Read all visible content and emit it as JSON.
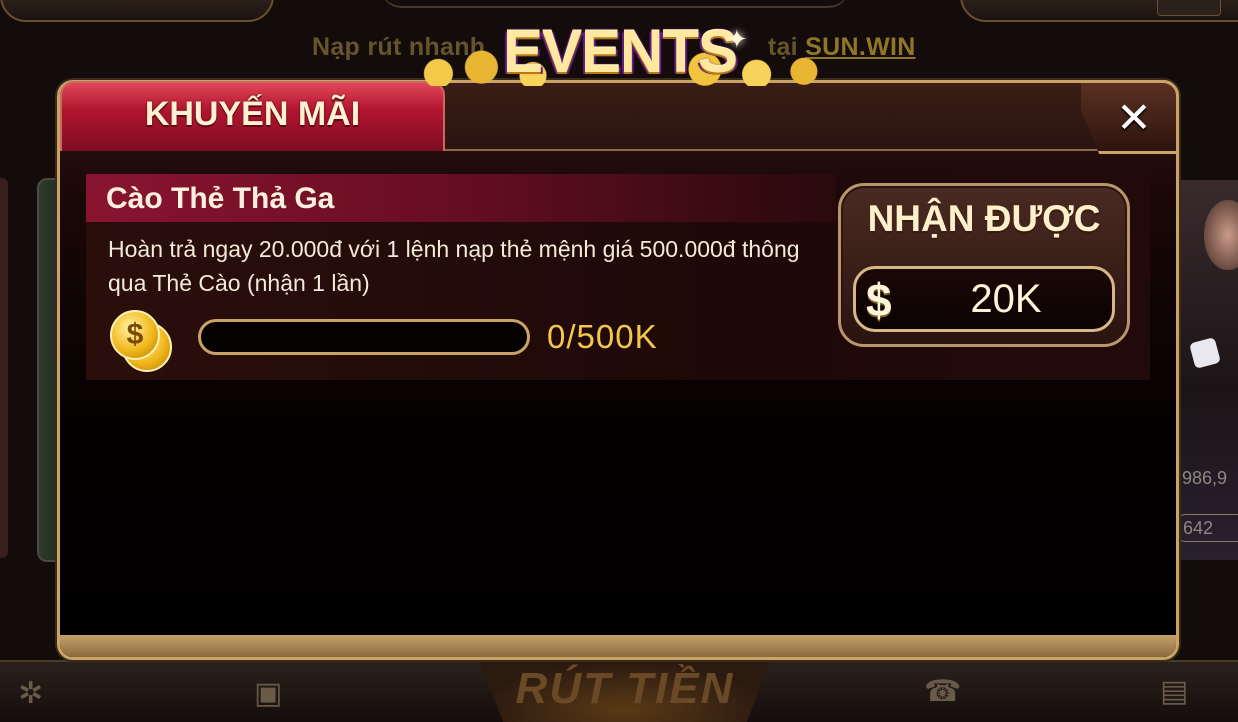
{
  "background": {
    "marquee": "Nạp rút nhanh",
    "marquee_tail": "tại",
    "marquee_domain": "SUN.WIN",
    "bottom_center": "RÚT TIỀN",
    "right_number_1": "986,9",
    "right_number_2": "642"
  },
  "events_badge": {
    "title": "EVENTS"
  },
  "popup": {
    "tab_label": "KHUYẾN MÃI",
    "close_symbol": "✕",
    "events": [
      {
        "title": "Cào Thẻ Thả Ga",
        "description": "Hoàn trả ngay 20.000đ với 1 lệnh nạp thẻ mệnh giá 500.000đ thông qua Thẻ Cào (nhận 1 lần)",
        "progress_text": "0/500K",
        "progress_fraction": 0,
        "reward_label": "NHẬN ĐƯỢC",
        "reward_currency_symbol": "$",
        "reward_value": "20K"
      }
    ]
  },
  "colors": {
    "accent_gold": "#c9a466",
    "tab_red": "#b1152f",
    "progress_text": "#f3c74a"
  }
}
